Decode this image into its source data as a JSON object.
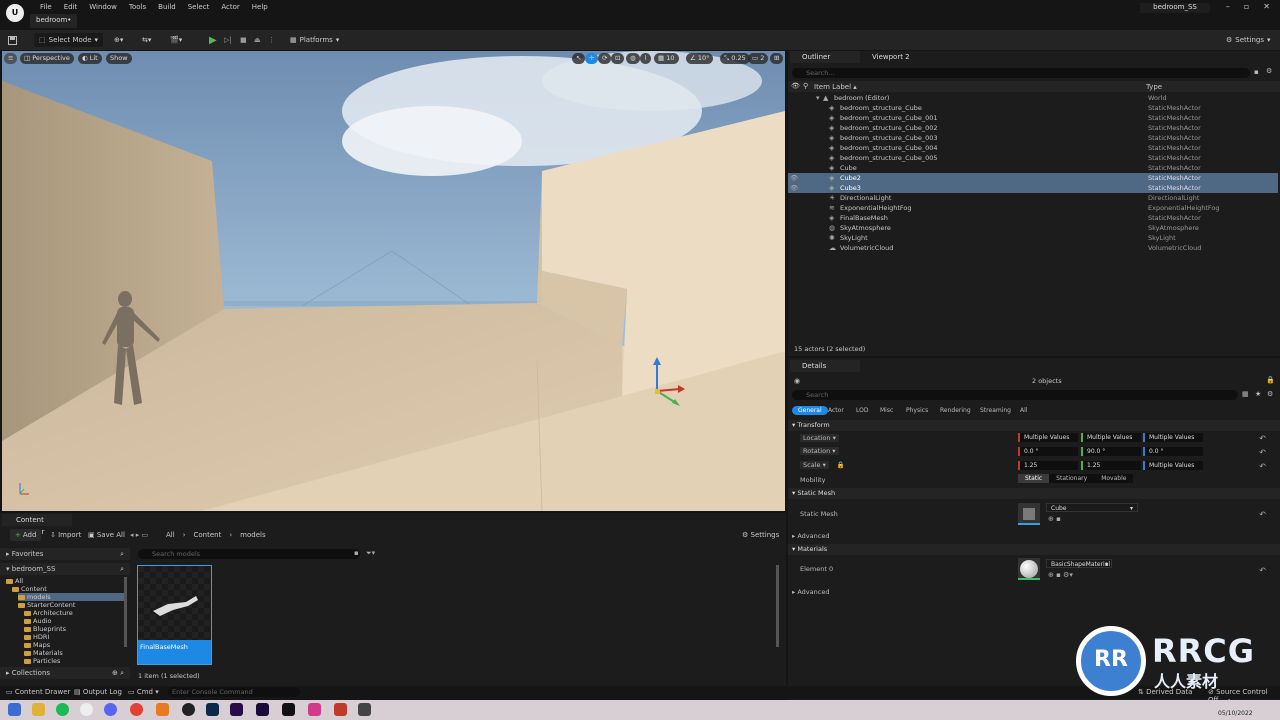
{
  "app": {
    "menu": [
      "File",
      "Edit",
      "Window",
      "Tools",
      "Build",
      "Select",
      "Actor",
      "Help"
    ],
    "doc_tab": "bedroom•",
    "project": "bedroom_SS"
  },
  "toolbar": {
    "select_mode": "Select Mode",
    "platforms": "Platforms",
    "settings": "Settings"
  },
  "viewport": {
    "perspective": "Perspective",
    "lit": "Lit",
    "show": "Show",
    "grid_snap": "10",
    "rot_snap": "10°",
    "scale_snap": "0.25",
    "cam_speed": "2",
    "colors": {
      "sky_top": "#7f9fbf",
      "floor": "#d6c3a7",
      "wall": "#e8d6bc"
    }
  },
  "outliner": {
    "tab": "Outliner",
    "tab2": "Viewport 2",
    "search_placeholder": "Search...",
    "col_label": "Item Label ▴",
    "col_type": "Type",
    "rows": [
      {
        "label": "bedroom (Editor)",
        "type": "World",
        "indent": 0,
        "icon": "world-icon"
      },
      {
        "label": "bedroom_structure_Cube",
        "type": "StaticMeshActor",
        "indent": 1,
        "icon": "mesh-icon"
      },
      {
        "label": "bedroom_structure_Cube_001",
        "type": "StaticMeshActor",
        "indent": 1,
        "icon": "mesh-icon"
      },
      {
        "label": "bedroom_structure_Cube_002",
        "type": "StaticMeshActor",
        "indent": 1,
        "icon": "mesh-icon"
      },
      {
        "label": "bedroom_structure_Cube_003",
        "type": "StaticMeshActor",
        "indent": 1,
        "icon": "mesh-icon"
      },
      {
        "label": "bedroom_structure_Cube_004",
        "type": "StaticMeshActor",
        "indent": 1,
        "icon": "mesh-icon"
      },
      {
        "label": "bedroom_structure_Cube_005",
        "type": "StaticMeshActor",
        "indent": 1,
        "icon": "mesh-icon"
      },
      {
        "label": "Cube",
        "type": "StaticMeshActor",
        "indent": 1,
        "icon": "mesh-icon"
      },
      {
        "label": "Cube2",
        "type": "StaticMeshActor",
        "indent": 1,
        "icon": "mesh-icon",
        "selected": true
      },
      {
        "label": "Cube3",
        "type": "StaticMeshActor",
        "indent": 1,
        "icon": "mesh-icon",
        "selected": true
      },
      {
        "label": "DirectionalLight",
        "type": "DirectionalLight",
        "indent": 1,
        "icon": "light-icon"
      },
      {
        "label": "ExponentialHeightFog",
        "type": "ExponentialHeightFog",
        "indent": 1,
        "icon": "fog-icon"
      },
      {
        "label": "FinalBaseMesh",
        "type": "StaticMeshActor",
        "indent": 1,
        "icon": "mesh-icon"
      },
      {
        "label": "SkyAtmosphere",
        "type": "SkyAtmosphere",
        "indent": 1,
        "icon": "sky-icon"
      },
      {
        "label": "SkyLight",
        "type": "SkyLight",
        "indent": 1,
        "icon": "skylight-icon"
      },
      {
        "label": "VolumetricCloud",
        "type": "VolumetricCloud",
        "indent": 1,
        "icon": "cloud-icon"
      }
    ],
    "footer": "15 actors (2 selected)"
  },
  "details": {
    "tab": "Details",
    "objects": "2 objects",
    "search_placeholder": "Search",
    "filter_tabs": [
      "General",
      "Actor",
      "LOD",
      "Misc",
      "Physics",
      "Rendering",
      "Streaming",
      "All"
    ],
    "transform": {
      "title": "Transform",
      "location_label": "Location",
      "rotation_label": "Rotation",
      "scale_label": "Scale",
      "location": [
        "Multiple Values",
        "Multiple Values",
        "Multiple Values"
      ],
      "rotation": [
        "0.0 °",
        "90.0 °",
        "0.0 °"
      ],
      "scale": [
        "1.25",
        "1.25",
        "Multiple Values"
      ],
      "mobility_label": "Mobility",
      "mobility_options": [
        "Static",
        "Stationary",
        "Movable"
      ]
    },
    "static_mesh": {
      "title": "Static Mesh",
      "label": "Static Mesh",
      "value": "Cube",
      "advanced": "Advanced"
    },
    "materials": {
      "title": "Materials",
      "label": "Element 0",
      "value": "BasicShapeMaterial",
      "advanced": "Advanced"
    }
  },
  "content_browser": {
    "tab": "Content Browser",
    "add": "Add",
    "import": "Import",
    "save_all": "Save All",
    "path": [
      "All",
      "Content",
      "models"
    ],
    "settings": "Settings",
    "favorites": "Favorites",
    "project": "bedroom_SS",
    "search_placeholder": "Search models",
    "tree": [
      {
        "label": "All",
        "depth": 0
      },
      {
        "label": "Content",
        "depth": 1
      },
      {
        "label": "models",
        "depth": 2,
        "selected": true
      },
      {
        "label": "StarterContent",
        "depth": 2
      },
      {
        "label": "Architecture",
        "depth": 3
      },
      {
        "label": "Audio",
        "depth": 3
      },
      {
        "label": "Blueprints",
        "depth": 3
      },
      {
        "label": "HDRI",
        "depth": 3
      },
      {
        "label": "Maps",
        "depth": 3
      },
      {
        "label": "Materials",
        "depth": 3
      },
      {
        "label": "Particles",
        "depth": 3
      }
    ],
    "collections": "Collections",
    "asset_name": "FinalBaseMesh",
    "footer": "1 item (1 selected)"
  },
  "statusbar": {
    "content_drawer": "Content Drawer",
    "output_log": "Output Log",
    "cmd": "Cmd",
    "console_placeholder": "Enter Console Command",
    "derived_data": "Derived Data",
    "source_control": "Source Control Off"
  },
  "clock": {
    "date": "05/10/2022"
  },
  "watermark": {
    "brand": "RRCG",
    "sub": "人人素材",
    "udemy": "udemy"
  }
}
